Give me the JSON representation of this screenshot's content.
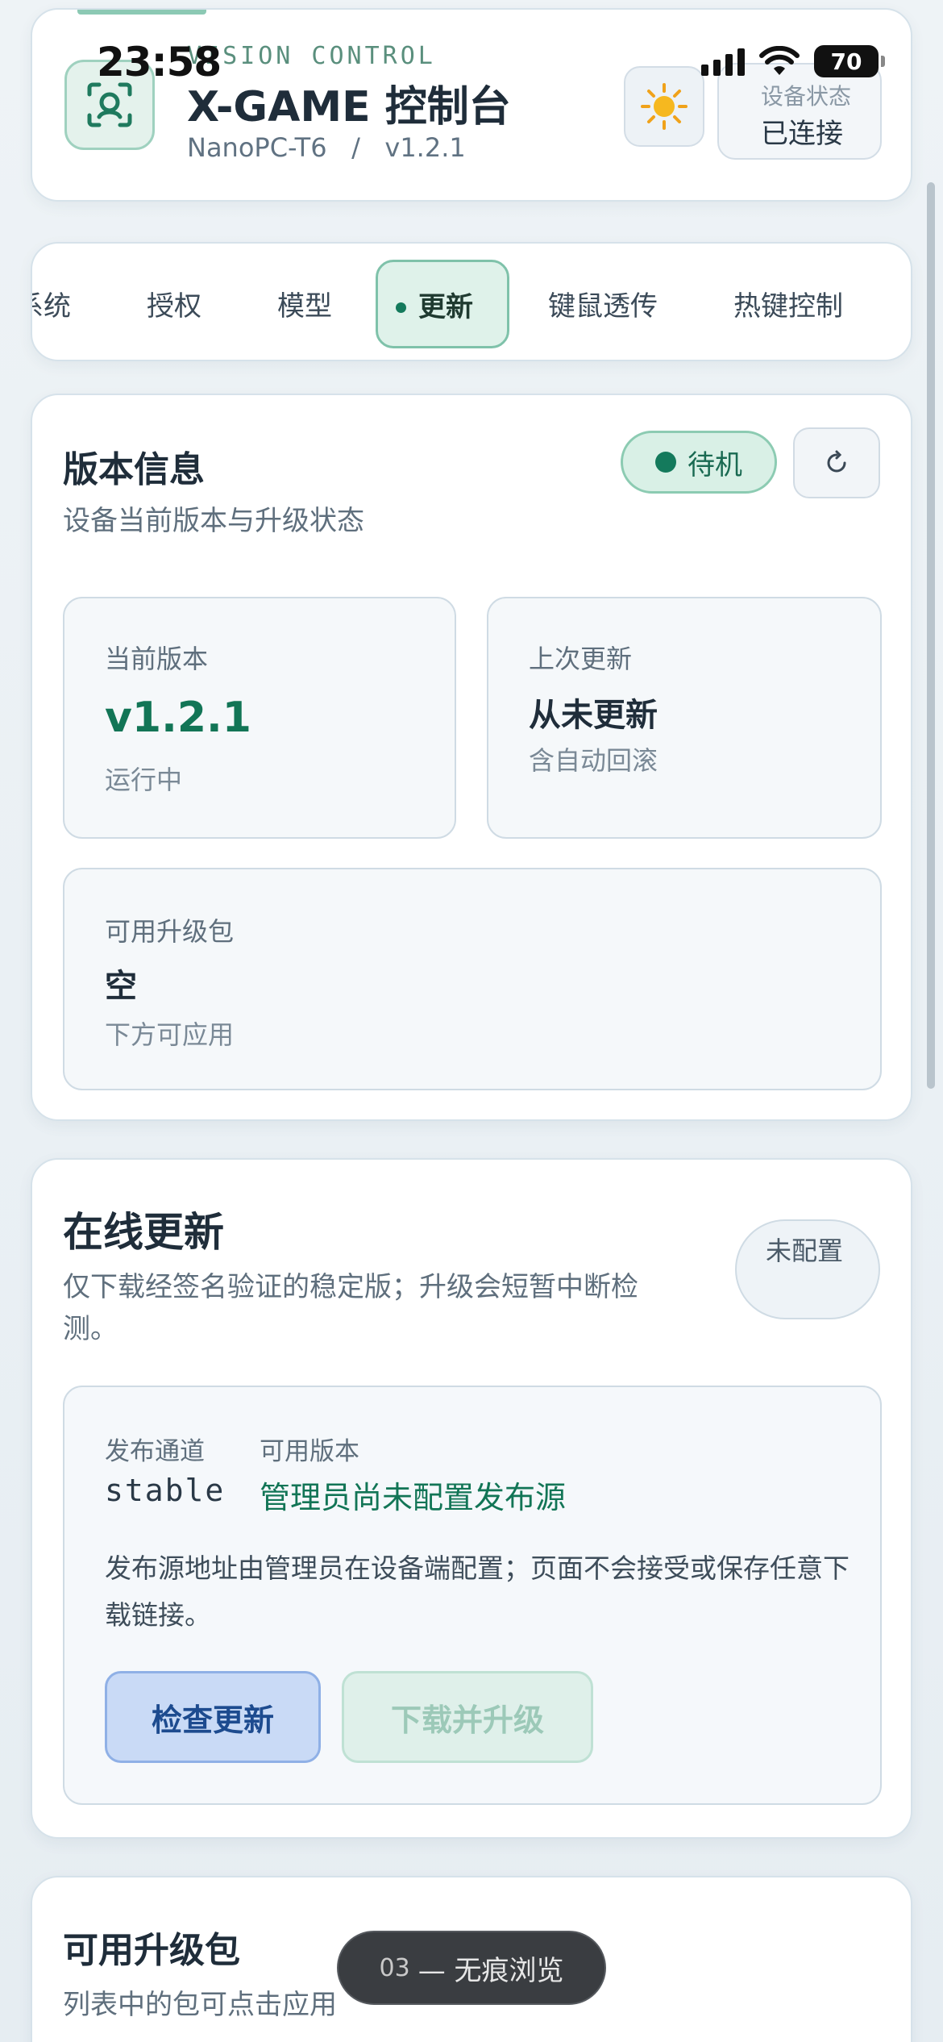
{
  "status_bar": {
    "time": "23:58",
    "battery": "70"
  },
  "header": {
    "kicker": "VISION CONTROL",
    "title": "X-GAME 控制台",
    "device": "NanoPC-T6",
    "separator": "/",
    "version": "v1.2.1",
    "logo_icon": "scan-eye-icon",
    "theme_icon": "sun-icon",
    "device_status_label": "设备状态",
    "device_status_value": "已连接"
  },
  "tabs": [
    {
      "label": "系统"
    },
    {
      "label": "授权"
    },
    {
      "label": "模型"
    },
    {
      "label": "更新",
      "active": true
    },
    {
      "label": "键鼠透传"
    },
    {
      "label": "热键控制"
    }
  ],
  "version_card": {
    "title": "版本信息",
    "subtitle": "设备当前版本与升级状态",
    "status_badge": "待机",
    "refresh_icon": "refresh-icon",
    "current": {
      "label": "当前版本",
      "value": "v1.2.1",
      "note": "运行中"
    },
    "last_update": {
      "label": "上次更新",
      "value": "从未更新",
      "note": "含自动回滚"
    },
    "available_pkg": {
      "label": "可用升级包",
      "value": "空",
      "note": "下方可应用"
    }
  },
  "online_card": {
    "title": "在线更新",
    "subtitle": "仅下载经签名验证的稳定版；升级会短暂中断检测。",
    "badge": "未配置",
    "channel_label": "发布通道",
    "channel_value": "stable",
    "available_label": "可用版本",
    "available_value": "管理员尚未配置发布源",
    "description": "发布源地址由管理员在设备端配置；页面不会接受或保存任意下载链接。",
    "check_button": "检查更新",
    "upgrade_button": "下载并升级"
  },
  "packages_card": {
    "title": "可用升级包",
    "subtitle": "列表中的包可点击应用"
  },
  "floating_pill": {
    "number": "03",
    "label": "— 无痕浏览"
  },
  "colors": {
    "accent_green": "#147a5c",
    "active_tab_bg": "#dff2ea",
    "primary_button_bg": "#c9daf6",
    "primary_button_text": "#1d4b8f"
  }
}
